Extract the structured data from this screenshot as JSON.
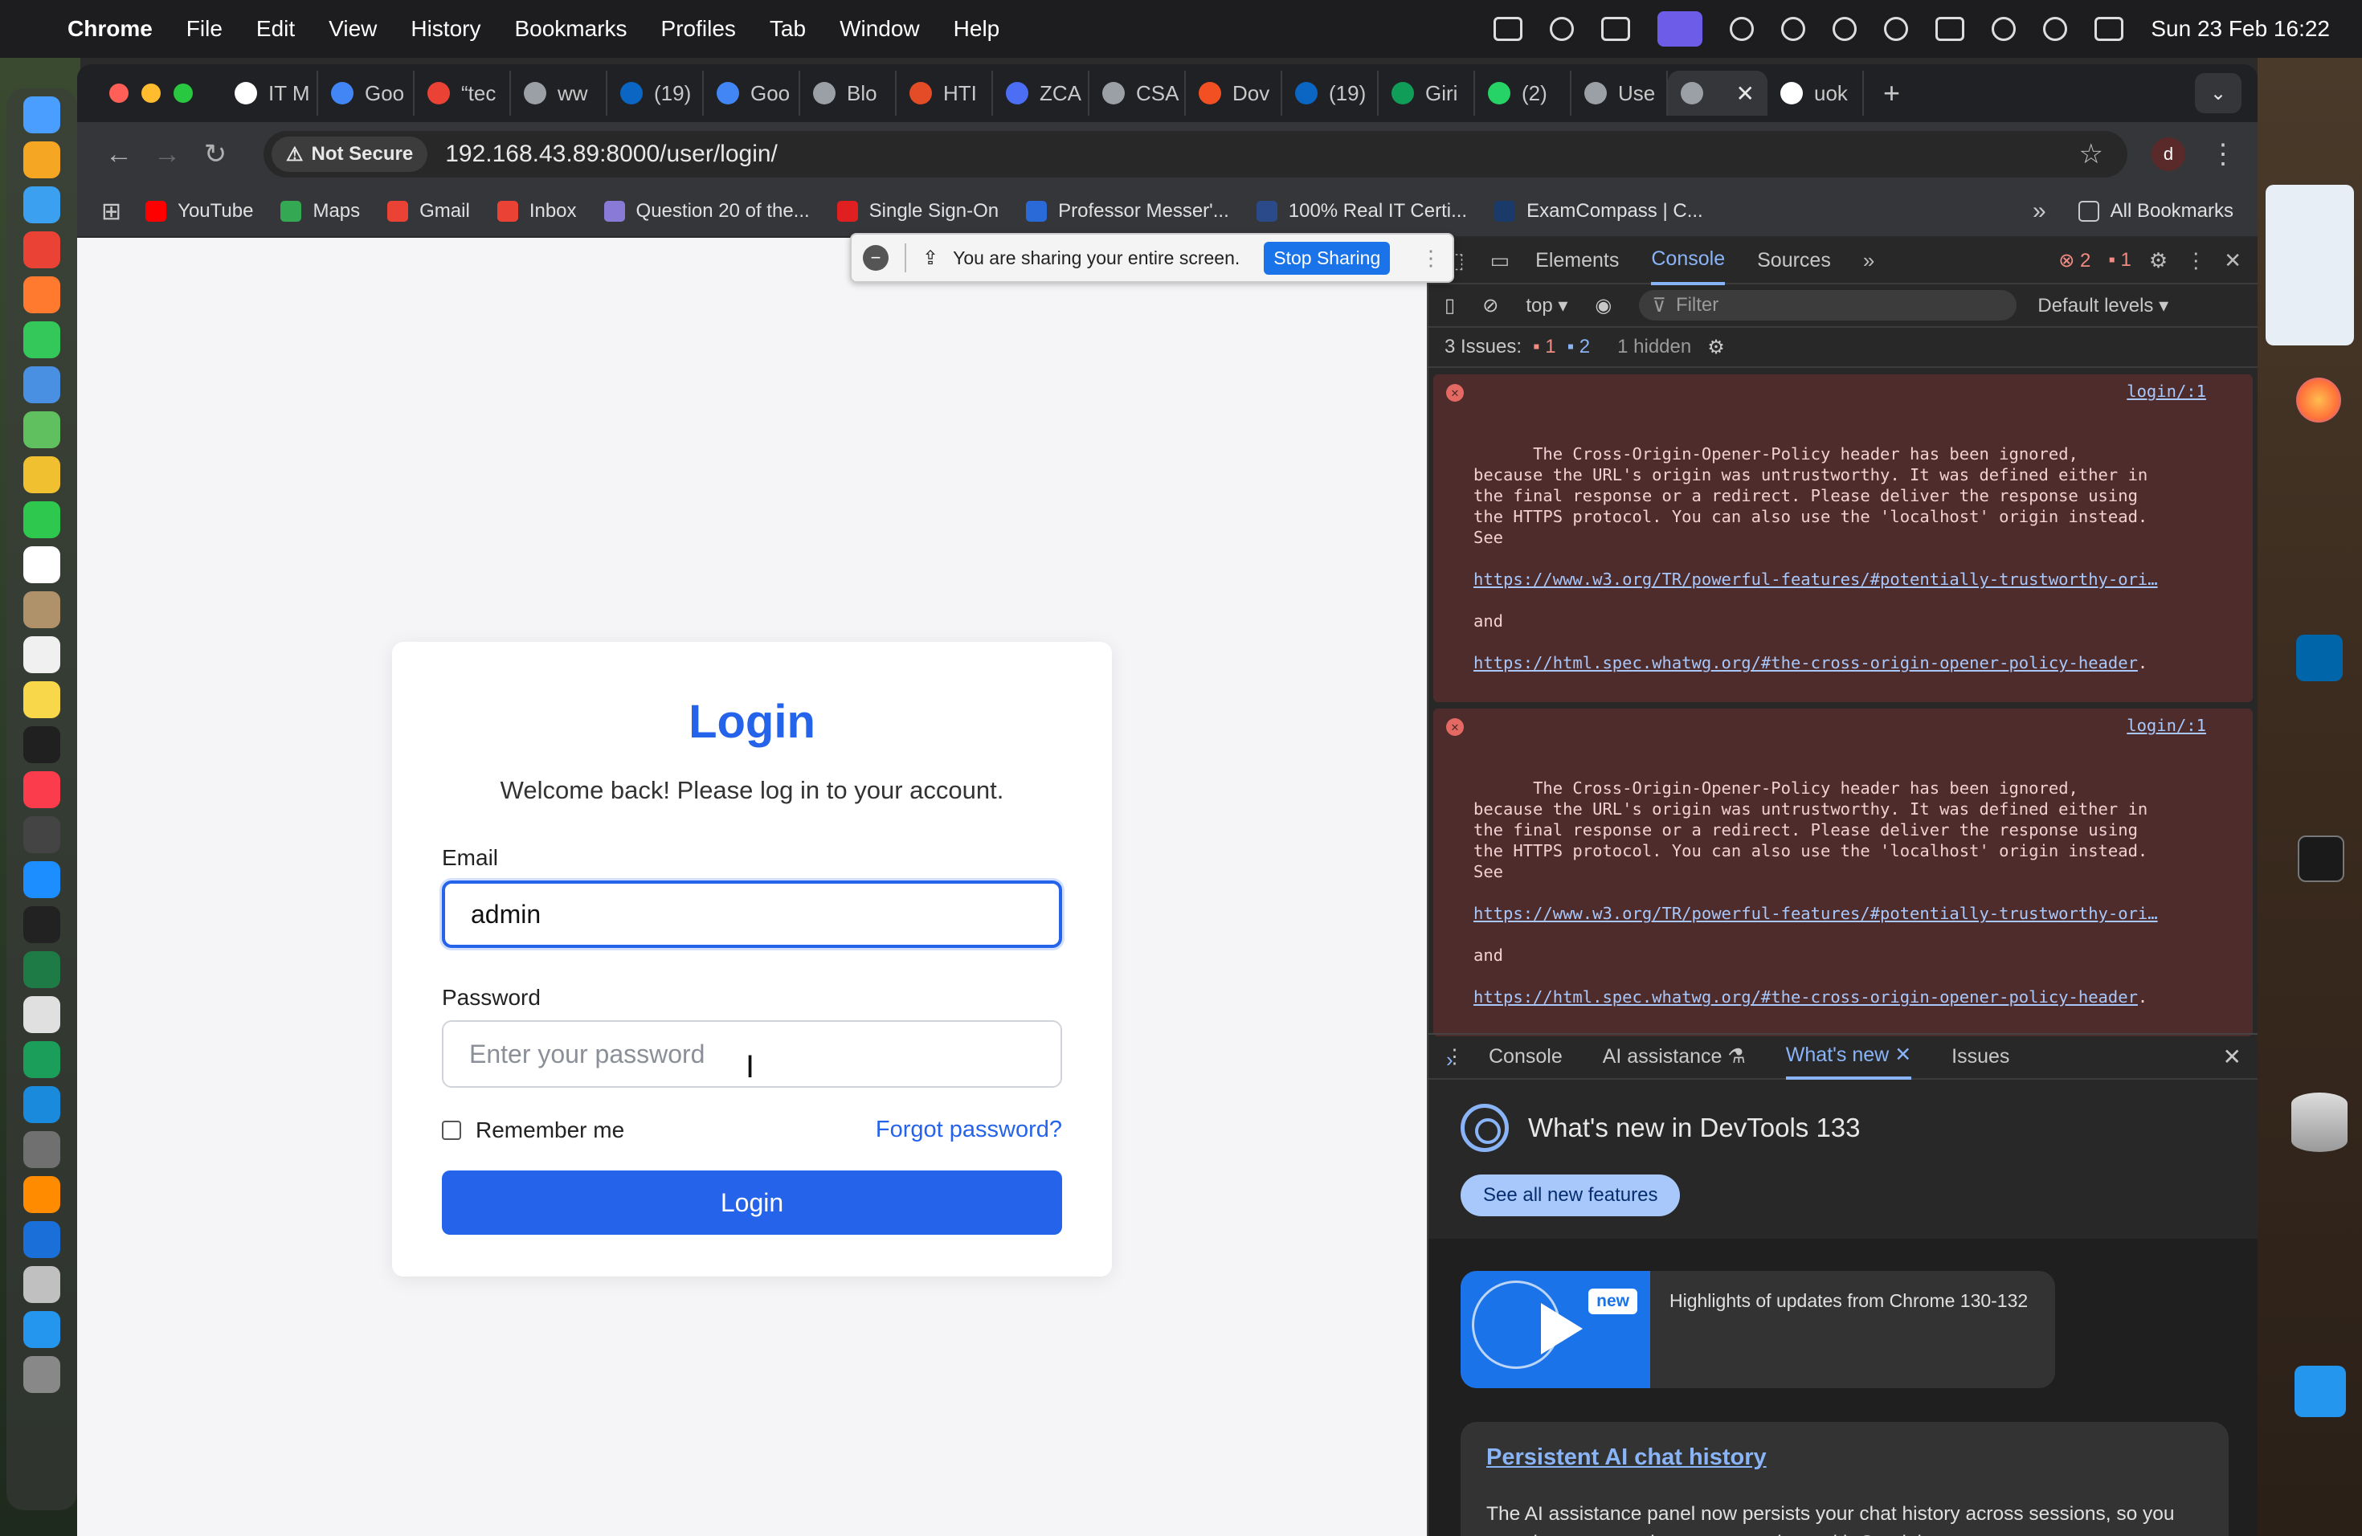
{
  "menubar": {
    "app": "Chrome",
    "items": [
      "File",
      "Edit",
      "View",
      "History",
      "Bookmarks",
      "Profiles",
      "Tab",
      "Window",
      "Help"
    ],
    "datetime": "Sun 23 Feb  16:22"
  },
  "tabs": [
    {
      "title": "IT M",
      "color": "#ffffff"
    },
    {
      "title": "Goo",
      "color": "#4285f4"
    },
    {
      "title": "“tec",
      "color": "#ea4335"
    },
    {
      "title": "ww",
      "color": "#9aa0a6"
    },
    {
      "title": "(19)",
      "color": "#0a66c2"
    },
    {
      "title": "Goo",
      "color": "#4285f4"
    },
    {
      "title": "Blo",
      "color": "#9aa0a6"
    },
    {
      "title": "HTI",
      "color": "#e34c26"
    },
    {
      "title": "ZCA",
      "color": "#4b6ef5"
    },
    {
      "title": "CSA",
      "color": "#9aa0a6"
    },
    {
      "title": "Dov",
      "color": "#f25022"
    },
    {
      "title": "(19)",
      "color": "#0a66c2"
    },
    {
      "title": "Giri",
      "color": "#0f9d58"
    },
    {
      "title": "(2)",
      "color": "#25d366"
    },
    {
      "title": "Use",
      "color": "#9aa0a6"
    },
    {
      "title": "",
      "color": "#9aa0a6",
      "active": true
    },
    {
      "title": "uok",
      "color": "#ffffff"
    }
  ],
  "toolbar": {
    "security": "Not Secure",
    "url": "192.168.43.89:8000/user/login/",
    "profile_initial": "d"
  },
  "bookmarks": [
    {
      "label": "YouTube",
      "color": "#ff0000"
    },
    {
      "label": "Maps",
      "color": "#34a853"
    },
    {
      "label": "Gmail",
      "color": "#ea4335"
    },
    {
      "label": "Inbox",
      "color": "#ea4335"
    },
    {
      "label": "Question 20 of the...",
      "color": "#8a7ad8"
    },
    {
      "label": "Single Sign-On",
      "color": "#e02020"
    },
    {
      "label": "Professor Messer'...",
      "color": "#2a6ad8"
    },
    {
      "label": "100% Real IT Certi...",
      "color": "#2a4a8a"
    },
    {
      "label": "ExamCompass | C...",
      "color": "#1a3a6a"
    }
  ],
  "bookmarks_all": "All Bookmarks",
  "sharing": {
    "message": "You are sharing your entire screen.",
    "stop_label": "Stop Sharing"
  },
  "login": {
    "title": "Login",
    "subtitle": "Welcome back! Please log in to your account.",
    "email_label": "Email",
    "email_value": "admin",
    "password_label": "Password",
    "password_placeholder": "Enter your password",
    "remember_label": "Remember me",
    "forgot_label": "Forgot password?",
    "submit_label": "Login"
  },
  "devtools": {
    "tabs": [
      "Elements",
      "Console",
      "Sources"
    ],
    "active_tab": "Console",
    "error_count": "2",
    "warning_count": "1",
    "context": "top ▾",
    "filter_placeholder": "Filter",
    "levels": "Default levels ▾",
    "issues_label": "3 Issues:",
    "issues_errors": "1",
    "issues_info": "2",
    "issues_hidden": "1 hidden",
    "messages": [
      {
        "text": "The Cross-Origin-Opener-Policy header has been ignored,\nbecause the URL's origin was untrustworthy. It was defined either in\nthe final response or a redirect. Please deliver the response using\nthe HTTPS protocol. You can also use the 'localhost' origin instead.\nSee",
        "link1": "https://www.w3.org/TR/powerful-features/#potentially-trustworthy-ori…",
        "and": "and",
        "link2": "https://html.spec.whatwg.org/#the-cross-origin-opener-policy-header",
        "source": "login/:1"
      },
      {
        "text": "The Cross-Origin-Opener-Policy header has been ignored,\nbecause the URL's origin was untrustworthy. It was defined either in\nthe final response or a redirect. Please deliver the response using\nthe HTTPS protocol. You can also use the 'localhost' origin instead.\nSee",
        "link1": "https://www.w3.org/TR/powerful-features/#potentially-trustworthy-ori…",
        "and": "and",
        "link2": "https://html.spec.whatwg.org/#the-cross-origin-opener-policy-header",
        "source": "login/:1"
      }
    ],
    "drawer_tabs": [
      "Console",
      "AI assistance",
      "What's new",
      "Issues"
    ],
    "whatsnew_title": "What's new in DevTools 133",
    "see_all": "See all new features",
    "highlight_badge": "new",
    "highlight_text": "Highlights of updates from Chrome 130-132",
    "ai_title": "Persistent AI chat history",
    "ai_text": "The AI assistance panel now persists your chat history across sessions, so you can view your previous conversations with Gemini."
  },
  "dock_colors": [
    "#4a9eff",
    "#f5a623",
    "#3ba0f0",
    "#ea4335",
    "#ff7a2f",
    "#34c759",
    "#4a90e2",
    "#60c060",
    "#f0c030",
    "#2dc84d",
    "#ffffff",
    "#b0926a",
    "#f0f0f0",
    "#f8d84a",
    "#202020",
    "#fa3c4c",
    "#444444",
    "#1c8eff",
    "#222222",
    "#1e7b45",
    "#e0e0e0",
    "#1a9e5a",
    "#1a8adc",
    "#707070",
    "#ff8c00",
    "#1a6fd8",
    "#c0c0c0",
    "#2496ed",
    "#888888"
  ]
}
